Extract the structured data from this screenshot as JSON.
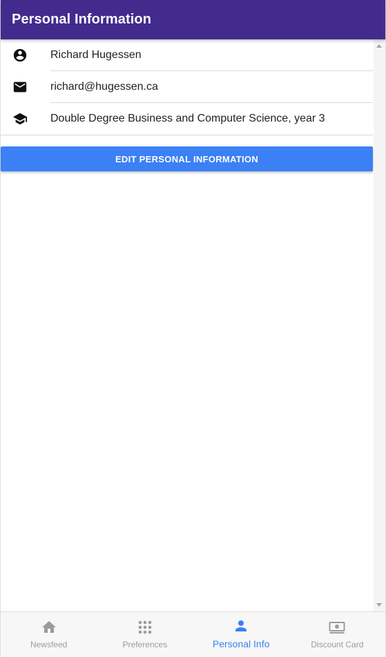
{
  "header": {
    "title": "Personal Information"
  },
  "profile": {
    "name": "Richard Hugessen",
    "email": "richard@hugessen.ca",
    "program": "Double Degree Business and Computer Science, year 3",
    "icons": [
      "account-circle-icon",
      "email-icon",
      "graduation-cap-icon"
    ]
  },
  "actions": {
    "edit_label": "EDIT PERSONAL INFORMATION"
  },
  "tabs": [
    {
      "label": "Newsfeed",
      "icon": "home-icon",
      "active": false
    },
    {
      "label": "Preferences",
      "icon": "grid-icon",
      "active": false
    },
    {
      "label": "Personal Info",
      "icon": "person-icon",
      "active": true
    },
    {
      "label": "Discount Card",
      "icon": "money-icon",
      "active": false
    }
  ],
  "colors": {
    "header_bg": "#432b8d",
    "accent": "#3b80f5",
    "inactive_tab": "#9b9b9b"
  }
}
